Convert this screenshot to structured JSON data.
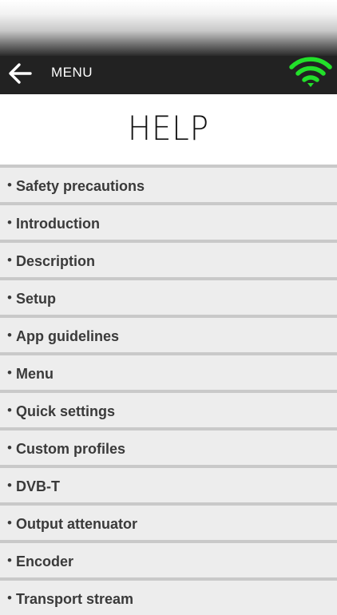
{
  "nav": {
    "back_icon": "arrow-left-icon",
    "menu_label": "MENU",
    "wifi_icon": "wifi-icon",
    "wifi_color": "#22e02a"
  },
  "page": {
    "title": "HELP"
  },
  "help_items": [
    {
      "bullet": "•",
      "label": "Safety precautions"
    },
    {
      "bullet": "•",
      "label": "Introduction"
    },
    {
      "bullet": "•",
      "label": "Description"
    },
    {
      "bullet": "•",
      "label": "Setup"
    },
    {
      "bullet": "•",
      "label": "App guidelines"
    },
    {
      "bullet": "•",
      "label": "Menu"
    },
    {
      "bullet": "•",
      "label": "Quick settings"
    },
    {
      "bullet": "•",
      "label": "Custom profiles"
    },
    {
      "bullet": "•",
      "label": "DVB-T"
    },
    {
      "bullet": "•",
      "label": "Output attenuator"
    },
    {
      "bullet": "•",
      "label": "Encoder"
    },
    {
      "bullet": "•",
      "label": "Transport stream"
    }
  ],
  "colors": {
    "nav_background": "#222222",
    "list_background": "#ededed",
    "list_divider": "#c9c9c9",
    "text": "#3a3a3a"
  }
}
